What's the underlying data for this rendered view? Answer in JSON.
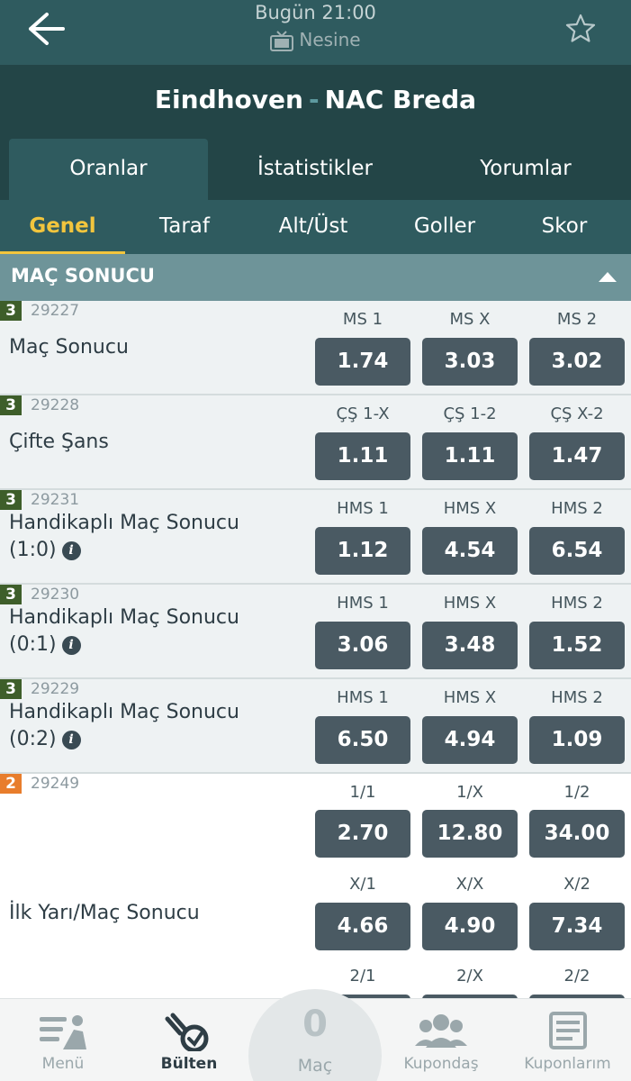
{
  "top": {
    "time": "Bugün 21:00",
    "channel": "Nesine"
  },
  "match": {
    "home": "Eindhoven",
    "separator": "-",
    "away": "NAC Breda"
  },
  "tabs": [
    {
      "label": "Oranlar"
    },
    {
      "label": "İstatistikler"
    },
    {
      "label": "Yorumlar"
    }
  ],
  "subtabs": [
    {
      "label": "Genel"
    },
    {
      "label": "Taraf"
    },
    {
      "label": "Alt/Üst"
    },
    {
      "label": "Goller"
    },
    {
      "label": "Skor"
    }
  ],
  "section": {
    "title": "MAÇ SONUCU"
  },
  "markets": [
    {
      "badge": "3",
      "code": "29227",
      "name": "Maç Sonucu",
      "name_suffix": "",
      "odds": [
        {
          "label": "MS 1",
          "value": "1.74"
        },
        {
          "label": "MS X",
          "value": "3.03"
        },
        {
          "label": "MS 2",
          "value": "3.02"
        }
      ]
    },
    {
      "badge": "3",
      "code": "29228",
      "name": "Çifte Şans",
      "name_suffix": "",
      "odds": [
        {
          "label": "ÇŞ 1-X",
          "value": "1.11"
        },
        {
          "label": "ÇŞ 1-2",
          "value": "1.11"
        },
        {
          "label": "ÇŞ X-2",
          "value": "1.47"
        }
      ]
    },
    {
      "badge": "3",
      "code": "29231",
      "name": "Handikaplı Maç Sonucu",
      "name_suffix": "(1:0)",
      "odds": [
        {
          "label": "HMS 1",
          "value": "1.12"
        },
        {
          "label": "HMS X",
          "value": "4.54"
        },
        {
          "label": "HMS 2",
          "value": "6.54"
        }
      ]
    },
    {
      "badge": "3",
      "code": "29230",
      "name": "Handikaplı Maç Sonucu",
      "name_suffix": "(0:1)",
      "odds": [
        {
          "label": "HMS 1",
          "value": "3.06"
        },
        {
          "label": "HMS X",
          "value": "3.48"
        },
        {
          "label": "HMS 2",
          "value": "1.52"
        }
      ]
    },
    {
      "badge": "3",
      "code": "29229",
      "name": "Handikaplı Maç Sonucu",
      "name_suffix": "(0:2)",
      "odds": [
        {
          "label": "HMS 1",
          "value": "6.50"
        },
        {
          "label": "HMS X",
          "value": "4.94"
        },
        {
          "label": "HMS 2",
          "value": "1.09"
        }
      ]
    }
  ],
  "htft": {
    "badge": "2",
    "code": "29249",
    "name": "İlk Yarı/Maç Sonucu",
    "rows": [
      [
        {
          "label": "1/1",
          "value": "2.70"
        },
        {
          "label": "1/X",
          "value": "12.80"
        },
        {
          "label": "1/2",
          "value": "34.00"
        }
      ],
      [
        {
          "label": "X/1",
          "value": "4.66"
        },
        {
          "label": "X/X",
          "value": "4.90"
        },
        {
          "label": "X/2",
          "value": "7.34"
        }
      ],
      [
        {
          "label": "2/1",
          "value": ""
        },
        {
          "label": "2/X",
          "value": ""
        },
        {
          "label": "2/2",
          "value": ""
        }
      ]
    ]
  },
  "bottom_nav": {
    "menu": "Menü",
    "bulten": "Bülten",
    "basket_count": "0",
    "basket_label": "Maç",
    "kupondas": "Kupondaş",
    "kuponlarim": "Kuponlarım"
  },
  "colors": {
    "topbar": "#2f5b5f",
    "header": "#234547",
    "accent": "#f2c53d",
    "odds_button": "#4a5a63",
    "badge_3": "#3e5e2a",
    "badge_2": "#e87d2c"
  }
}
